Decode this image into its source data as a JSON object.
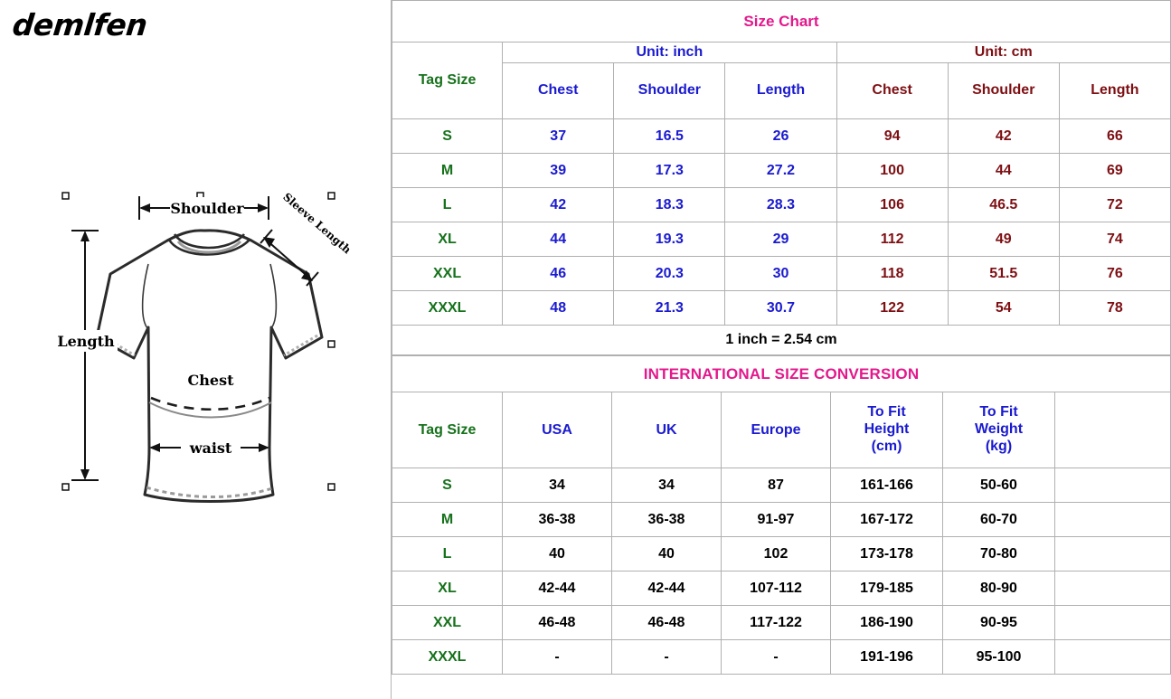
{
  "brand": {
    "name": "demlfen"
  },
  "diagram": {
    "labels": {
      "shoulder": "Shoulder",
      "sleeve_length": "Sleeve Length",
      "chest": "Chest",
      "length": "Length",
      "waist": "waist"
    }
  },
  "size_chart": {
    "title": "Size Chart",
    "unit_inch": "Unit: inch",
    "unit_cm": "Unit: cm",
    "tag_size_header": "Tag Size",
    "columns_inch": [
      "Chest",
      "Shoulder",
      "Length"
    ],
    "columns_cm": [
      "Chest",
      "Shoulder",
      "Length"
    ],
    "note": "1 inch = 2.54 cm",
    "rows": [
      {
        "tag": "S",
        "inch": [
          "37",
          "16.5",
          "26"
        ],
        "cm": [
          "94",
          "42",
          "66"
        ]
      },
      {
        "tag": "M",
        "inch": [
          "39",
          "17.3",
          "27.2"
        ],
        "cm": [
          "100",
          "44",
          "69"
        ]
      },
      {
        "tag": "L",
        "inch": [
          "42",
          "18.3",
          "28.3"
        ],
        "cm": [
          "106",
          "46.5",
          "72"
        ]
      },
      {
        "tag": "XL",
        "inch": [
          "44",
          "19.3",
          "29"
        ],
        "cm": [
          "112",
          "49",
          "74"
        ]
      },
      {
        "tag": "XXL",
        "inch": [
          "46",
          "20.3",
          "30"
        ],
        "cm": [
          "118",
          "51.5",
          "76"
        ]
      },
      {
        "tag": "XXXL",
        "inch": [
          "48",
          "21.3",
          "30.7"
        ],
        "cm": [
          "122",
          "54",
          "78"
        ]
      }
    ]
  },
  "international": {
    "title": "INTERNATIONAL SIZE CONVERSION",
    "tag_size_header": "Tag Size",
    "columns": [
      "USA",
      "UK",
      "Europe",
      "To Fit Height (cm)",
      "To Fit Weight (kg)"
    ],
    "column_height_line1": "To Fit",
    "column_height_line2": "Height",
    "column_height_line3": "(cm)",
    "column_weight_line1": "To Fit",
    "column_weight_line2": "Weight",
    "column_weight_line3": "(kg)",
    "rows": [
      {
        "tag": "S",
        "usa": "34",
        "uk": "34",
        "europe": "87",
        "height": "161-166",
        "weight": "50-60",
        "extra": ""
      },
      {
        "tag": "M",
        "usa": "36-38",
        "uk": "36-38",
        "europe": "91-97",
        "height": "167-172",
        "weight": "60-70",
        "extra": ""
      },
      {
        "tag": "L",
        "usa": "40",
        "uk": "40",
        "europe": "102",
        "height": "173-178",
        "weight": "70-80",
        "extra": ""
      },
      {
        "tag": "XL",
        "usa": "42-44",
        "uk": "42-44",
        "europe": "107-112",
        "height": "179-185",
        "weight": "80-90",
        "extra": ""
      },
      {
        "tag": "XXL",
        "usa": "46-48",
        "uk": "46-48",
        "europe": "117-122",
        "height": "186-190",
        "weight": "90-95",
        "extra": ""
      },
      {
        "tag": "XXXL",
        "usa": "-",
        "uk": "-",
        "europe": "-",
        "height": "191-196",
        "weight": "95-100",
        "extra": ""
      }
    ]
  },
  "colors": {
    "title_pink": "#e3188c",
    "tag_green": "#16711b",
    "inch_blue": "#1a1ad0",
    "cm_darkred": "#7d0f13",
    "value_black": "#000000",
    "border_gray": "#b0b0b0"
  }
}
